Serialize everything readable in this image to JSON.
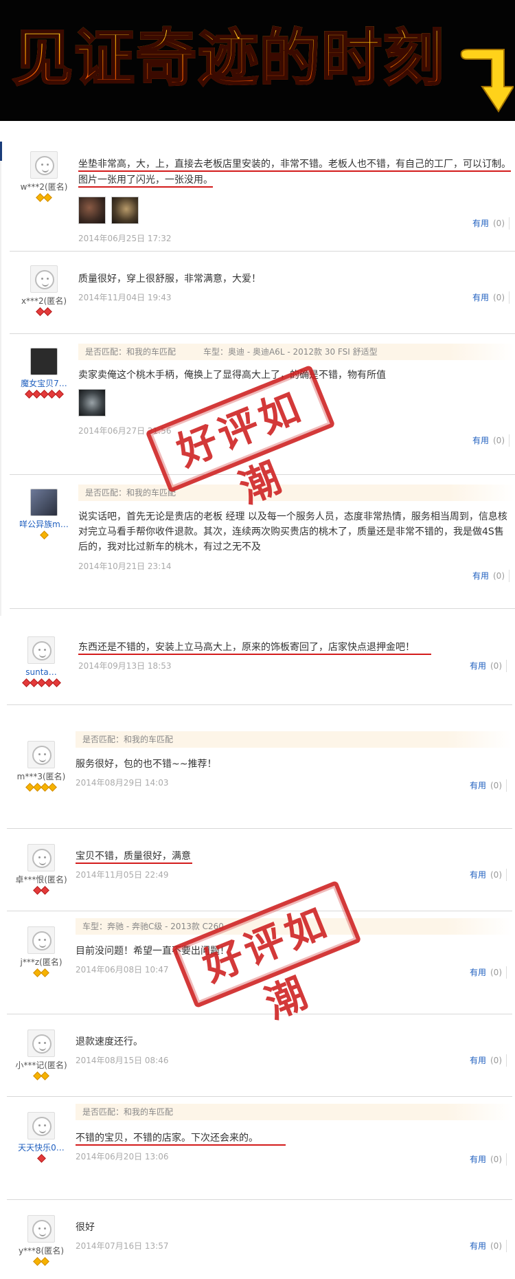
{
  "banner": {
    "title": "见证奇迹的时刻"
  },
  "labels": {
    "useful": "有用",
    "stamp": "好评如潮"
  },
  "reviews": [
    {
      "nick": "w***2(匿名)",
      "badge": "gold",
      "badge_count": 2,
      "meta": [],
      "content": "坐垫非常高，大，上，直接去老板店里安装的，非常不错。老板人也不错，有自己的工厂，可以订制。图片一张用了闪光，一张没用。",
      "date": "2014年06月25日 17:32",
      "useful_count": "(0)"
    },
    {
      "nick": "x***2(匿名)",
      "badge": "red",
      "badge_count": 2,
      "meta": [],
      "content": "质量很好，穿上很舒服，非常满意，大爱！",
      "date": "2014年11月04日 19:43",
      "useful_count": "(0)"
    },
    {
      "nick": "魔女宝贝7…",
      "badge": "red",
      "badge_count": 5,
      "meta": [
        "是否匹配：和我的车匹配",
        "车型：奥迪 - 奥迪A6L - 2012款 30 FSI 舒适型"
      ],
      "content": "卖家卖俺这个桃木手柄，俺换上了显得高大上了，的确是不错，物有所值",
      "date": "2014年06月27日 21:56",
      "useful_count": "(0)"
    },
    {
      "nick": "咩公异族m…",
      "badge": "gold",
      "badge_count": 1,
      "meta": [
        "是否匹配：和我的车匹配"
      ],
      "content": "说实话吧，首先无论是贵店的老板 经理 以及每一个服务人员，态度非常热情，服务相当周到，信息核对完立马看手帮你收件退款。其次，连续两次购买贵店的桃木了，质量还是非常不错的，我是做4S售后的，我对比过新车的桃木，有过之无不及",
      "date": "2014年10月21日 23:14",
      "useful_count": "(0)"
    },
    {
      "nick": "sunta…",
      "badge": "red",
      "badge_count": 5,
      "meta": [],
      "content": "东西还是不错的，安装上立马高大上，原来的饰板寄回了，店家快点退押金吧！",
      "date": "2014年09月13日 18:53",
      "useful_count": "(0)"
    },
    {
      "nick": "m***3(匿名)",
      "badge": "gold",
      "badge_count": 4,
      "meta": [
        "是否匹配：和我的车匹配"
      ],
      "content": "服务很好，包的也不错~~推荐！",
      "date": "2014年08月29日 14:03",
      "useful_count": "(0)"
    },
    {
      "nick": "卓***恨(匿名)",
      "badge": "red",
      "badge_count": 2,
      "meta": [],
      "content": "宝贝不错，质量很好，满意",
      "date": "2014年11月05日 22:49",
      "useful_count": "(0)"
    },
    {
      "nick": "j***z(匿名)",
      "badge": "gold",
      "badge_count": 2,
      "meta": [
        "车型：奔驰 - 奔驰C级 - 2013款 C260"
      ],
      "content": "目前没问题！希望一直不要出问题！",
      "date": "2014年06月08日 10:47",
      "useful_count": "(0)"
    },
    {
      "nick": "小***记(匿名)",
      "badge": "gold",
      "badge_count": 2,
      "meta": [],
      "content": "退款速度还行。",
      "date": "2014年08月15日 08:46",
      "useful_count": "(0)"
    },
    {
      "nick": "天天快乐0…",
      "badge": "red",
      "badge_count": 1,
      "meta": [
        "是否匹配：和我的车匹配"
      ],
      "content": "不错的宝贝，不错的店家。下次还会来的。",
      "date": "2014年06月20日 13:06",
      "useful_count": "(0)"
    },
    {
      "nick": "y***8(匿名)",
      "badge": "gold",
      "badge_count": 2,
      "meta": [],
      "content": "很好",
      "date": "2014年07月16日 13:57",
      "useful_count": "(0)"
    }
  ],
  "colors": {
    "banner_bg": "#030303",
    "link_blue": "#1f5fbf",
    "underline_red": "#d31b1b",
    "stamp_red": "#cd1e1e",
    "meta_bg": "#fdf5e8"
  },
  "icons": {
    "banner_arrow": "yellow-down-arrow-icon",
    "badge_gold": "gold-diamond-icon",
    "badge_red": "red-heart-diamond-icon",
    "default_avatar": "smiley-avatar-icon"
  }
}
